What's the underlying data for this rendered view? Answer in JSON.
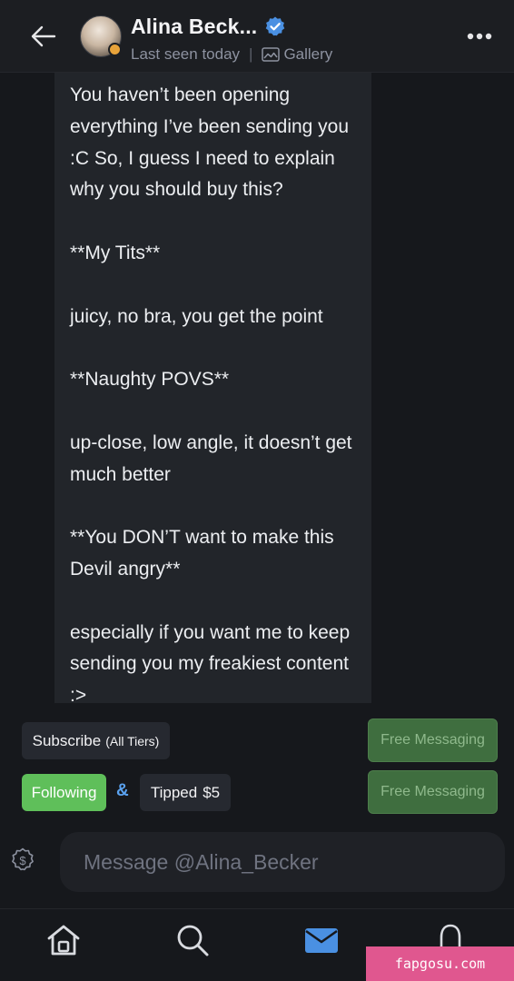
{
  "header": {
    "name": "Alina Beck...",
    "status": "Last seen today",
    "separator": "|",
    "gallery_label": "Gallery"
  },
  "message": {
    "text": "You haven’t been opening everything I’ve been sending you :C So, I guess I need to explain why you should buy this?\n\n**My Tits**\n\njuicy, no bra, you get the point\n\n**Naughty POVS**\n\nup-close, low angle, it doesn’t get much better\n\n**You DON’T want to make this Devil angry**\n\nespecially if you want me to keep sending you my freakiest content :>"
  },
  "actions": {
    "subscribe_label": "Subscribe",
    "subscribe_tiers": "(All Tiers)",
    "following_label": "Following",
    "ampersand": "&",
    "tipped_label": "Tipped",
    "tipped_amount": "$5",
    "free_messaging_1": "Free Messaging",
    "free_messaging_2": "Free Messaging"
  },
  "composer": {
    "placeholder": "Message @Alina_Becker"
  },
  "nav": {
    "items": [
      "home-icon",
      "search-icon",
      "messages-icon",
      "notifications-icon"
    ],
    "active": "messages-icon"
  },
  "watermark": "fapgosu.com",
  "colors": {
    "background": "#16181c",
    "accent_blue": "#4a90e2",
    "following_green": "#5fbf5a",
    "free_messaging_green": "#3f6e3f",
    "watermark_pink": "#e0578f"
  }
}
